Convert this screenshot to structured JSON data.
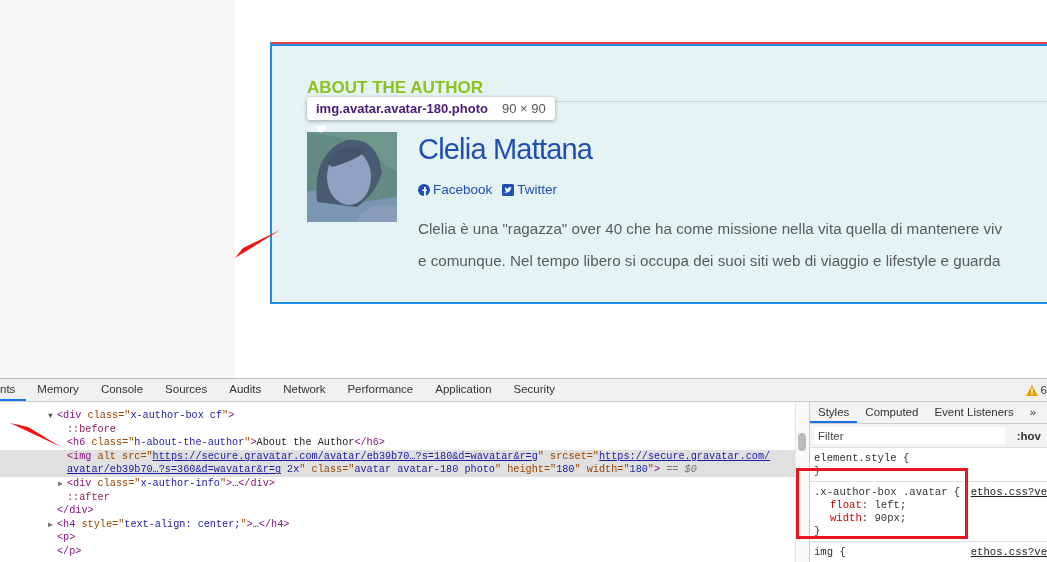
{
  "author_box": {
    "heading": "ABOUT THE AUTHOR",
    "name": "Clelia Mattana",
    "links": [
      {
        "kind": "facebook",
        "label": "Facebook"
      },
      {
        "kind": "twitter",
        "label": "Twitter"
      }
    ],
    "bio_lines": [
      "Clelia è una \"ragazza\" over 40 che ha come missione nella vita quella di mantenere viv",
      "e comunque. Nel tempo libero si occupa dei suoi siti web di viaggio e lifestyle e guarda"
    ]
  },
  "inspect_tooltip": {
    "selector": "img.avatar.avatar-180.photo",
    "size": "90 × 90"
  },
  "devtools": {
    "tabs": [
      {
        "label": "nts",
        "selected": true
      },
      {
        "label": "Memory",
        "selected": false
      },
      {
        "label": "Console",
        "selected": false
      },
      {
        "label": "Sources",
        "selected": false
      },
      {
        "label": "Audits",
        "selected": false
      },
      {
        "label": "Network",
        "selected": false
      },
      {
        "label": "Performance",
        "selected": false
      },
      {
        "label": "Application",
        "selected": false
      },
      {
        "label": "Security",
        "selected": false
      }
    ],
    "warning_count": "6",
    "dom_tree": [
      {
        "selected": false,
        "expanded": true,
        "triangle": "▼",
        "tokens": [
          {
            "kind": "tag",
            "text": "<div"
          },
          {
            "kind": "attr",
            "text": " class=\""
          },
          {
            "kind": "value",
            "text": "x-author-box cf"
          },
          {
            "kind": "attr",
            "text": "\""
          },
          {
            "kind": "tag",
            "text": ">"
          }
        ],
        "children": [
          {
            "selected": false,
            "tokens": [
              {
                "kind": "pseudo",
                "text": "::before"
              }
            ]
          },
          {
            "selected": false,
            "tokens": [
              {
                "kind": "tag",
                "text": "<h6"
              },
              {
                "kind": "attr",
                "text": " class=\""
              },
              {
                "kind": "value",
                "text": "h-about-the-author"
              },
              {
                "kind": "attr",
                "text": "\""
              },
              {
                "kind": "tag",
                "text": ">"
              },
              {
                "kind": "text",
                "text": "About the Author"
              },
              {
                "kind": "tag",
                "text": "</h6>"
              }
            ]
          },
          {
            "selected": true,
            "tokens": [
              {
                "kind": "tag",
                "text": "<img"
              },
              {
                "kind": "attr",
                "text": " alt src=\""
              },
              {
                "kind": "link",
                "text": "https://secure.gravatar.com/avatar/eb39b70…?s=180&d=wavatar&r=g"
              },
              {
                "kind": "attr",
                "text": "\" srcset=\""
              },
              {
                "kind": "link",
                "text": "https://secure.gravatar.com/avatar/eb39b70…?s=360&d=wavatar&r=g"
              },
              {
                "kind": "value",
                "text": " 2x"
              },
              {
                "kind": "attr",
                "text": "\" class=\""
              },
              {
                "kind": "value",
                "text": "avatar avatar-180 photo"
              },
              {
                "kind": "attr",
                "text": "\" height=\""
              },
              {
                "kind": "value",
                "text": "180"
              },
              {
                "kind": "attr",
                "text": "\" width=\""
              },
              {
                "kind": "value",
                "text": "180"
              },
              {
                "kind": "attr",
                "text": "\""
              },
              {
                "kind": "tag",
                "text": ">"
              },
              {
                "kind": "marker",
                "text": " == $0"
              }
            ]
          },
          {
            "selected": false,
            "expanded": false,
            "triangle": "▶",
            "tokens": [
              {
                "kind": "tag",
                "text": "<div"
              },
              {
                "kind": "attr",
                "text": " class=\""
              },
              {
                "kind": "value",
                "text": "x-author-info"
              },
              {
                "kind": "attr",
                "text": "\""
              },
              {
                "kind": "tag",
                "text": ">"
              },
              {
                "kind": "text",
                "text": "…"
              },
              {
                "kind": "tag",
                "text": "</div>"
              }
            ]
          },
          {
            "selected": false,
            "tokens": [
              {
                "kind": "pseudo",
                "text": "::after"
              }
            ]
          }
        ],
        "closing": [
          {
            "kind": "tag",
            "text": "</div>"
          }
        ]
      },
      {
        "selected": false,
        "expanded": false,
        "triangle": "▶",
        "tokens": [
          {
            "kind": "tag",
            "text": "<h4"
          },
          {
            "kind": "attr",
            "text": " style=\""
          },
          {
            "kind": "value",
            "text": "text-align: center;"
          },
          {
            "kind": "attr",
            "text": "\""
          },
          {
            "kind": "tag",
            "text": ">"
          },
          {
            "kind": "text",
            "text": "…"
          },
          {
            "kind": "tag",
            "text": "</h4>"
          }
        ]
      },
      {
        "selected": false,
        "tokens": [
          {
            "kind": "tag",
            "text": "<p>"
          }
        ]
      },
      {
        "selected": false,
        "tokens": [
          {
            "kind": "tag",
            "text": "</p>"
          }
        ]
      }
    ],
    "styles_tabs": [
      {
        "label": "Styles",
        "selected": true
      },
      {
        "label": "Computed",
        "selected": false
      },
      {
        "label": "Event Listeners",
        "selected": false
      }
    ],
    "more_tabs": "»",
    "filter": {
      "placeholder": "Filter"
    },
    "hov": ":hov",
    "rules": [
      {
        "selector": "element.style {",
        "close": "}"
      },
      {
        "selector": ".x-author-box .avatar {",
        "source": "ethos.css?ve",
        "declarations": [
          {
            "property": "float",
            "value": ": left;"
          },
          {
            "property": "width",
            "value": ": 90px;"
          }
        ],
        "close": "}"
      },
      {
        "selector": "img {",
        "source": "ethos.css?ve"
      }
    ]
  }
}
